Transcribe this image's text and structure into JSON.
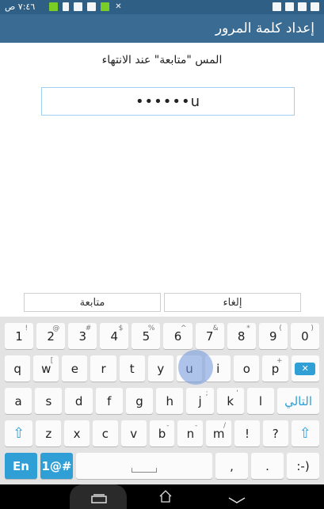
{
  "status": {
    "time": "٧:٤٦ ص"
  },
  "appbar": {
    "title": "إعداد كلمة المرور"
  },
  "prompt": "المس \"متابعة\" عند الانتهاء",
  "password_field": {
    "value": "••••••u"
  },
  "actions": {
    "cancel": "إلغاء",
    "continue": "متابعة"
  },
  "keyboard": {
    "row1": [
      {
        "k": "1",
        "s": "!"
      },
      {
        "k": "2",
        "s": "@"
      },
      {
        "k": "3",
        "s": "#"
      },
      {
        "k": "4",
        "s": "$"
      },
      {
        "k": "5",
        "s": "%"
      },
      {
        "k": "6",
        "s": "^"
      },
      {
        "k": "7",
        "s": "&"
      },
      {
        "k": "8",
        "s": "*"
      },
      {
        "k": "9",
        "s": "("
      },
      {
        "k": "0",
        "s": ")"
      }
    ],
    "row2": [
      {
        "k": "q",
        "s": ""
      },
      {
        "k": "w",
        "s": "["
      },
      {
        "k": "e",
        "s": ""
      },
      {
        "k": "r",
        "s": ""
      },
      {
        "k": "t",
        "s": ""
      },
      {
        "k": "y",
        "s": ""
      },
      {
        "k": "u",
        "s": ""
      },
      {
        "k": "i",
        "s": ""
      },
      {
        "k": "o",
        "s": ""
      },
      {
        "k": "p",
        "s": "+"
      }
    ],
    "row3": [
      {
        "k": "a",
        "s": ""
      },
      {
        "k": "s",
        "s": ""
      },
      {
        "k": "d",
        "s": ""
      },
      {
        "k": "f",
        "s": ""
      },
      {
        "k": "g",
        "s": ""
      },
      {
        "k": "h",
        "s": ""
      },
      {
        "k": "j",
        "s": ";"
      },
      {
        "k": "k",
        "s": "'"
      },
      {
        "k": "l",
        "s": ""
      }
    ],
    "row4": [
      {
        "k": "z",
        "s": ""
      },
      {
        "k": "x",
        "s": ""
      },
      {
        "k": "c",
        "s": ""
      },
      {
        "k": "v",
        "s": ""
      },
      {
        "k": "b",
        "s": "-"
      },
      {
        "k": "n",
        "s": "-"
      },
      {
        "k": "m",
        "s": "/"
      },
      {
        "k": "!",
        "s": ""
      },
      {
        "k": "?",
        "s": ""
      }
    ],
    "next_label": "التالي",
    "lang_key": "En",
    "symbols_key": "1@#",
    "comma": ",",
    "period": ".",
    "emoji": ":-)",
    "shift": "⇧",
    "backspace": "⌫"
  }
}
